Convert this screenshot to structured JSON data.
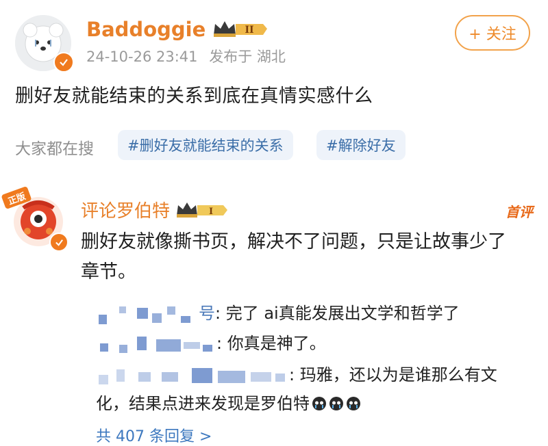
{
  "post": {
    "username": "Baddoggie",
    "level_badge": "II",
    "timestamp": "24-10-26 23:41",
    "location": "发布于 湖北",
    "follow_label": "+ 关注",
    "text": "删好友就能结束的关系到底在真情实感什么"
  },
  "search": {
    "label": "大家都在搜",
    "tags": [
      "#删好友就能结束的关系",
      "#解除好友"
    ]
  },
  "comment": {
    "username": "评论罗伯特",
    "level_badge": "I",
    "first_label": "首评",
    "avatar_badge": "正版",
    "text": "删好友就像撕书页，解决不了问题，只是让故事少了章节。"
  },
  "replies": [
    {
      "name_tail": "号",
      "text": ": 完了 ai真能发展出文学和哲学了"
    },
    {
      "name_tail": "",
      "text": ": 你真是神了。"
    },
    {
      "name_tail": "",
      "text_line1": ": 玛雅，还以为是谁那么有文",
      "text_line2": "化，结果点进来发现是罗伯特",
      "emoji": [
        "tear-emoji",
        "tear-emoji",
        "tear-emoji"
      ]
    }
  ],
  "more_replies": "共 407 条回复 >",
  "colors": {
    "accent_orange": "#e8802a",
    "link_blue": "#3d78bf",
    "tag_bg": "#eef3fa"
  }
}
